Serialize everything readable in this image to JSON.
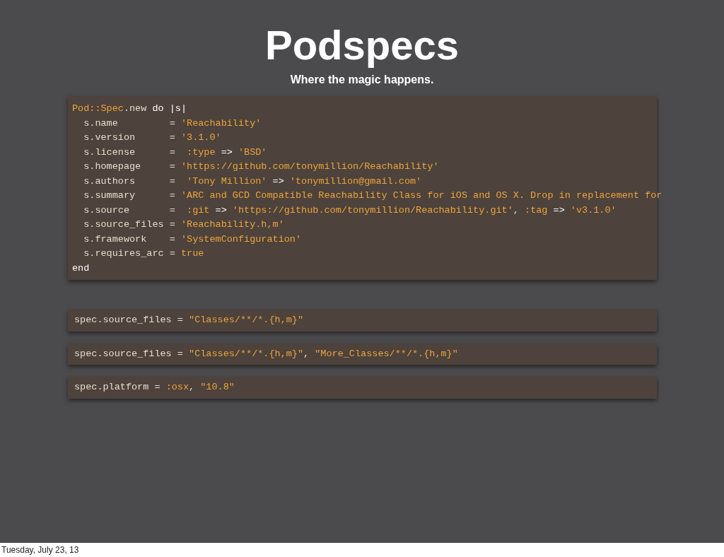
{
  "slide": {
    "title": "Podspecs",
    "subtitle": "Where the magic happens."
  },
  "code_blocks": [
    {
      "lines": [
        [
          {
            "kind": "accent",
            "text": "Pod::Spec"
          },
          {
            "kind": "plain",
            "text": ".new "
          },
          {
            "kind": "keyword",
            "text": "do |s|"
          }
        ],
        [
          {
            "kind": "plain",
            "text": "  s.name         = "
          },
          {
            "kind": "accent",
            "text": "'Reachability'"
          }
        ],
        [
          {
            "kind": "plain",
            "text": "  s.version      = "
          },
          {
            "kind": "accent",
            "text": "'3.1.0'"
          }
        ],
        [
          {
            "kind": "plain",
            "text": "  s.license      =  "
          },
          {
            "kind": "accent",
            "text": ":type "
          },
          {
            "kind": "keyword",
            "text": "=> "
          },
          {
            "kind": "accent",
            "text": "'BSD'"
          }
        ],
        [
          {
            "kind": "plain",
            "text": "  s.homepage     = "
          },
          {
            "kind": "accent",
            "text": "'https://github.com/tonymillion/Reachability'"
          }
        ],
        [
          {
            "kind": "plain",
            "text": "  s.authors      =  "
          },
          {
            "kind": "accent",
            "text": "'Tony Million' "
          },
          {
            "kind": "keyword",
            "text": "=> "
          },
          {
            "kind": "accent",
            "text": "'tonymillion@gmail.com'"
          }
        ],
        [
          {
            "kind": "plain",
            "text": "  s.summary      = "
          },
          {
            "kind": "accent",
            "text": "'ARC and GCD Compatible Reachability Class for iOS and OS X. Drop in replacement for"
          }
        ],
        [
          {
            "kind": "plain",
            "text": "  s.source       =  "
          },
          {
            "kind": "accent",
            "text": ":git "
          },
          {
            "kind": "keyword",
            "text": "=> "
          },
          {
            "kind": "accent",
            "text": "'https://github.com/tonymillion/Reachability.git'"
          },
          {
            "kind": "plain",
            "text": ", "
          },
          {
            "kind": "accent",
            "text": ":tag "
          },
          {
            "kind": "keyword",
            "text": "=> "
          },
          {
            "kind": "accent",
            "text": "'v3.1.0'"
          }
        ],
        [
          {
            "kind": "plain",
            "text": "  s.source_files = "
          },
          {
            "kind": "accent",
            "text": "'Reachability.h,m'"
          }
        ],
        [
          {
            "kind": "plain",
            "text": "  s.framework    = "
          },
          {
            "kind": "accent",
            "text": "'SystemConfiguration'"
          }
        ],
        [
          {
            "kind": "plain",
            "text": "  s.requires_arc = "
          },
          {
            "kind": "accent",
            "text": "true"
          }
        ],
        [
          {
            "kind": "keyword",
            "text": "end"
          }
        ]
      ]
    },
    {
      "lines": [
        [
          {
            "kind": "plain",
            "text": "spec.source_files = "
          },
          {
            "kind": "accent",
            "text": "\"Classes/**/*.{h,m}\""
          }
        ]
      ]
    },
    {
      "lines": [
        [
          {
            "kind": "plain",
            "text": "spec.source_files = "
          },
          {
            "kind": "accent",
            "text": "\"Classes/**/*.{h,m}\""
          },
          {
            "kind": "plain",
            "text": ", "
          },
          {
            "kind": "accent",
            "text": "\"More_Classes/**/*.{h,m}\""
          }
        ]
      ]
    },
    {
      "lines": [
        [
          {
            "kind": "plain",
            "text": "spec.platform = "
          },
          {
            "kind": "accent",
            "text": ":osx"
          },
          {
            "kind": "plain",
            "text": ", "
          },
          {
            "kind": "accent",
            "text": "\"10.8\""
          }
        ]
      ]
    }
  ],
  "footer": {
    "date": "Tuesday, July 23, 13"
  }
}
